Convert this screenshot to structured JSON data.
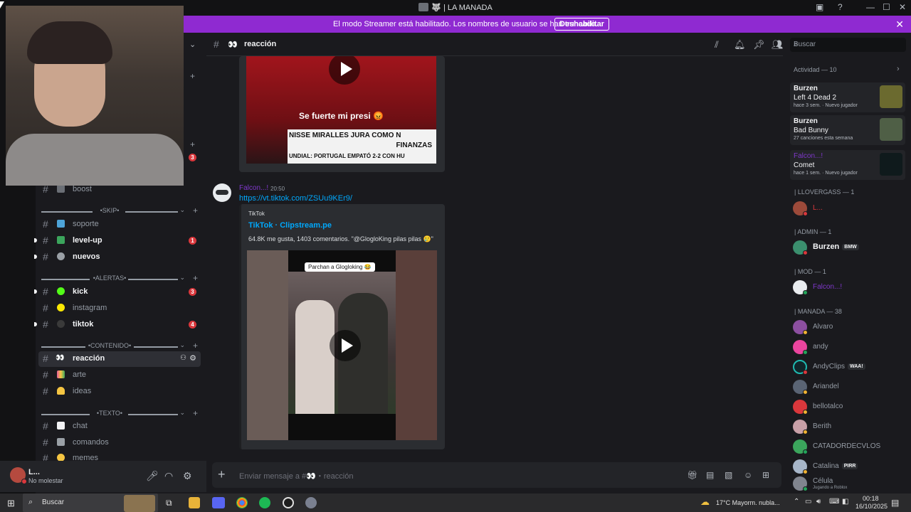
{
  "window": {
    "title": "| LA MANADA",
    "title_emoji": "🐺"
  },
  "banner": {
    "text": "El modo Streamer está habilitado. Los nombres de usuario se han truncado.",
    "button": "Deshabilitar"
  },
  "channel": {
    "name": "reacción",
    "emoji": "👀",
    "placeholder": "Enviar mensaje a #👀・reacción"
  },
  "search": {
    "placeholder": "Buscar"
  },
  "sidebar": {
    "channels_top": [
      {
        "emoji": "🐺",
        "name": "boost",
        "unread": false
      }
    ],
    "cat_skip": "•SKIP•",
    "skip": [
      {
        "name": "soporte",
        "color": "#4da3d8",
        "unread": false
      },
      {
        "name": "level-up",
        "color": "#3ba55c",
        "unread": true,
        "badge": "1"
      },
      {
        "name": "nuevos",
        "color": "#9aa0a6",
        "unread": true
      }
    ],
    "cat_alertas": "•ALERTAS•",
    "alertas": [
      {
        "name": "kick",
        "color": "#53fc18",
        "unread": true,
        "badge": "3"
      },
      {
        "name": "instagram",
        "color": "#fce803",
        "unread": false
      },
      {
        "name": "tiktok",
        "color": "#3a3a3a",
        "unread": true,
        "badge": "4"
      }
    ],
    "cat_contenido": "•CONTENIDO•",
    "contenido": [
      {
        "name": "reacción",
        "color": "#f2f3f5",
        "active": true
      },
      {
        "name": "arte",
        "color": "#e85d9a",
        "unread": false
      },
      {
        "name": "ideas",
        "color": "#f5c542",
        "unread": false
      }
    ],
    "cat_texto": "•TEXTO•",
    "texto": [
      {
        "name": "chat",
        "color": "#f2f3f5"
      },
      {
        "name": "comandos",
        "color": "#9aa0a6"
      },
      {
        "name": "memes",
        "color": "#f5c542"
      }
    ],
    "top_badge": "3"
  },
  "user": {
    "name": "L...",
    "status": "No molestar"
  },
  "messages": {
    "video1_caption": "Se fuerte mi presi 😡",
    "video1_line1": "NISSE MIRALLES JURA COMO N",
    "video1_line2": "FINANZAS",
    "video1_line3": "UNDIAL: PORTUGAL EMPATÓ 2-2 CON HU",
    "author": "Falcon...!",
    "time": "20:50",
    "link": "https://vt.tiktok.com/ZSUu9KEr9/",
    "embed_provider": "TikTok",
    "embed_title": "TikTok · Clipstream.pe",
    "embed_desc": "64.8K me gusta, 1403 comentarios. \"@GlogloKing pilas pilas 🥲\"",
    "video2_caption": "Parchan a Glogloking 😂"
  },
  "members": {
    "activity_title": "Actividad — 10",
    "activities": [
      {
        "user": "Burzen",
        "game": "Left 4 Dead 2",
        "meta": "hace 3 sem. · Nuevo jugador"
      },
      {
        "user": "Burzen",
        "game": "Bad Bunny",
        "meta": "27 canciones esta semana"
      },
      {
        "user": "Falcon...!",
        "game": "Comet",
        "meta": "hace 1 sem. · Nuevo jugador"
      }
    ],
    "role_llovergass": "| LLOVERGASS — 1",
    "llovergass": [
      {
        "name": "L...",
        "color": "#da373c"
      }
    ],
    "role_admin": "| ADMIN — 1",
    "admin": [
      {
        "name": "Burzen",
        "tag": "BMW"
      }
    ],
    "role_mod": "| MOD — 1",
    "mod": [
      {
        "name": "Falcon...!"
      }
    ],
    "role_manada": "| MANADA — 38",
    "manada": [
      {
        "name": "Alvaro"
      },
      {
        "name": "andy"
      },
      {
        "name": "AndyClips",
        "tag": "WAA!"
      },
      {
        "name": "Ariandel"
      },
      {
        "name": "bellotalco"
      },
      {
        "name": "Berith"
      },
      {
        "name": "CATADORDECVLOS"
      },
      {
        "name": "Catalina",
        "tag": "PIRR"
      },
      {
        "name": "Célula",
        "sub": "Jugando a Roblox"
      }
    ]
  },
  "taskbar": {
    "search": "Buscar",
    "weather": "17°C  Mayorm. nubla...",
    "time": "00:18",
    "date": "16/10/2025"
  },
  "colors": {
    "accent": "#8f2ad1",
    "link": "#00a8fc",
    "dnd": "#da373c",
    "online": "#23a55a"
  }
}
